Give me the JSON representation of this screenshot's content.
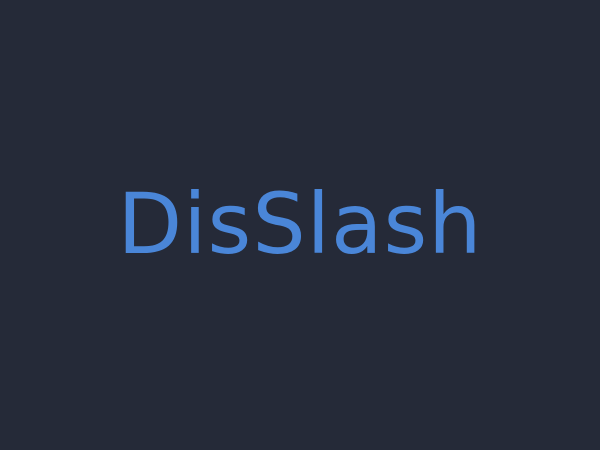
{
  "brand": {
    "name": "DisSlash"
  },
  "colors": {
    "background": "#252a38",
    "accent": "#4a86d8"
  }
}
